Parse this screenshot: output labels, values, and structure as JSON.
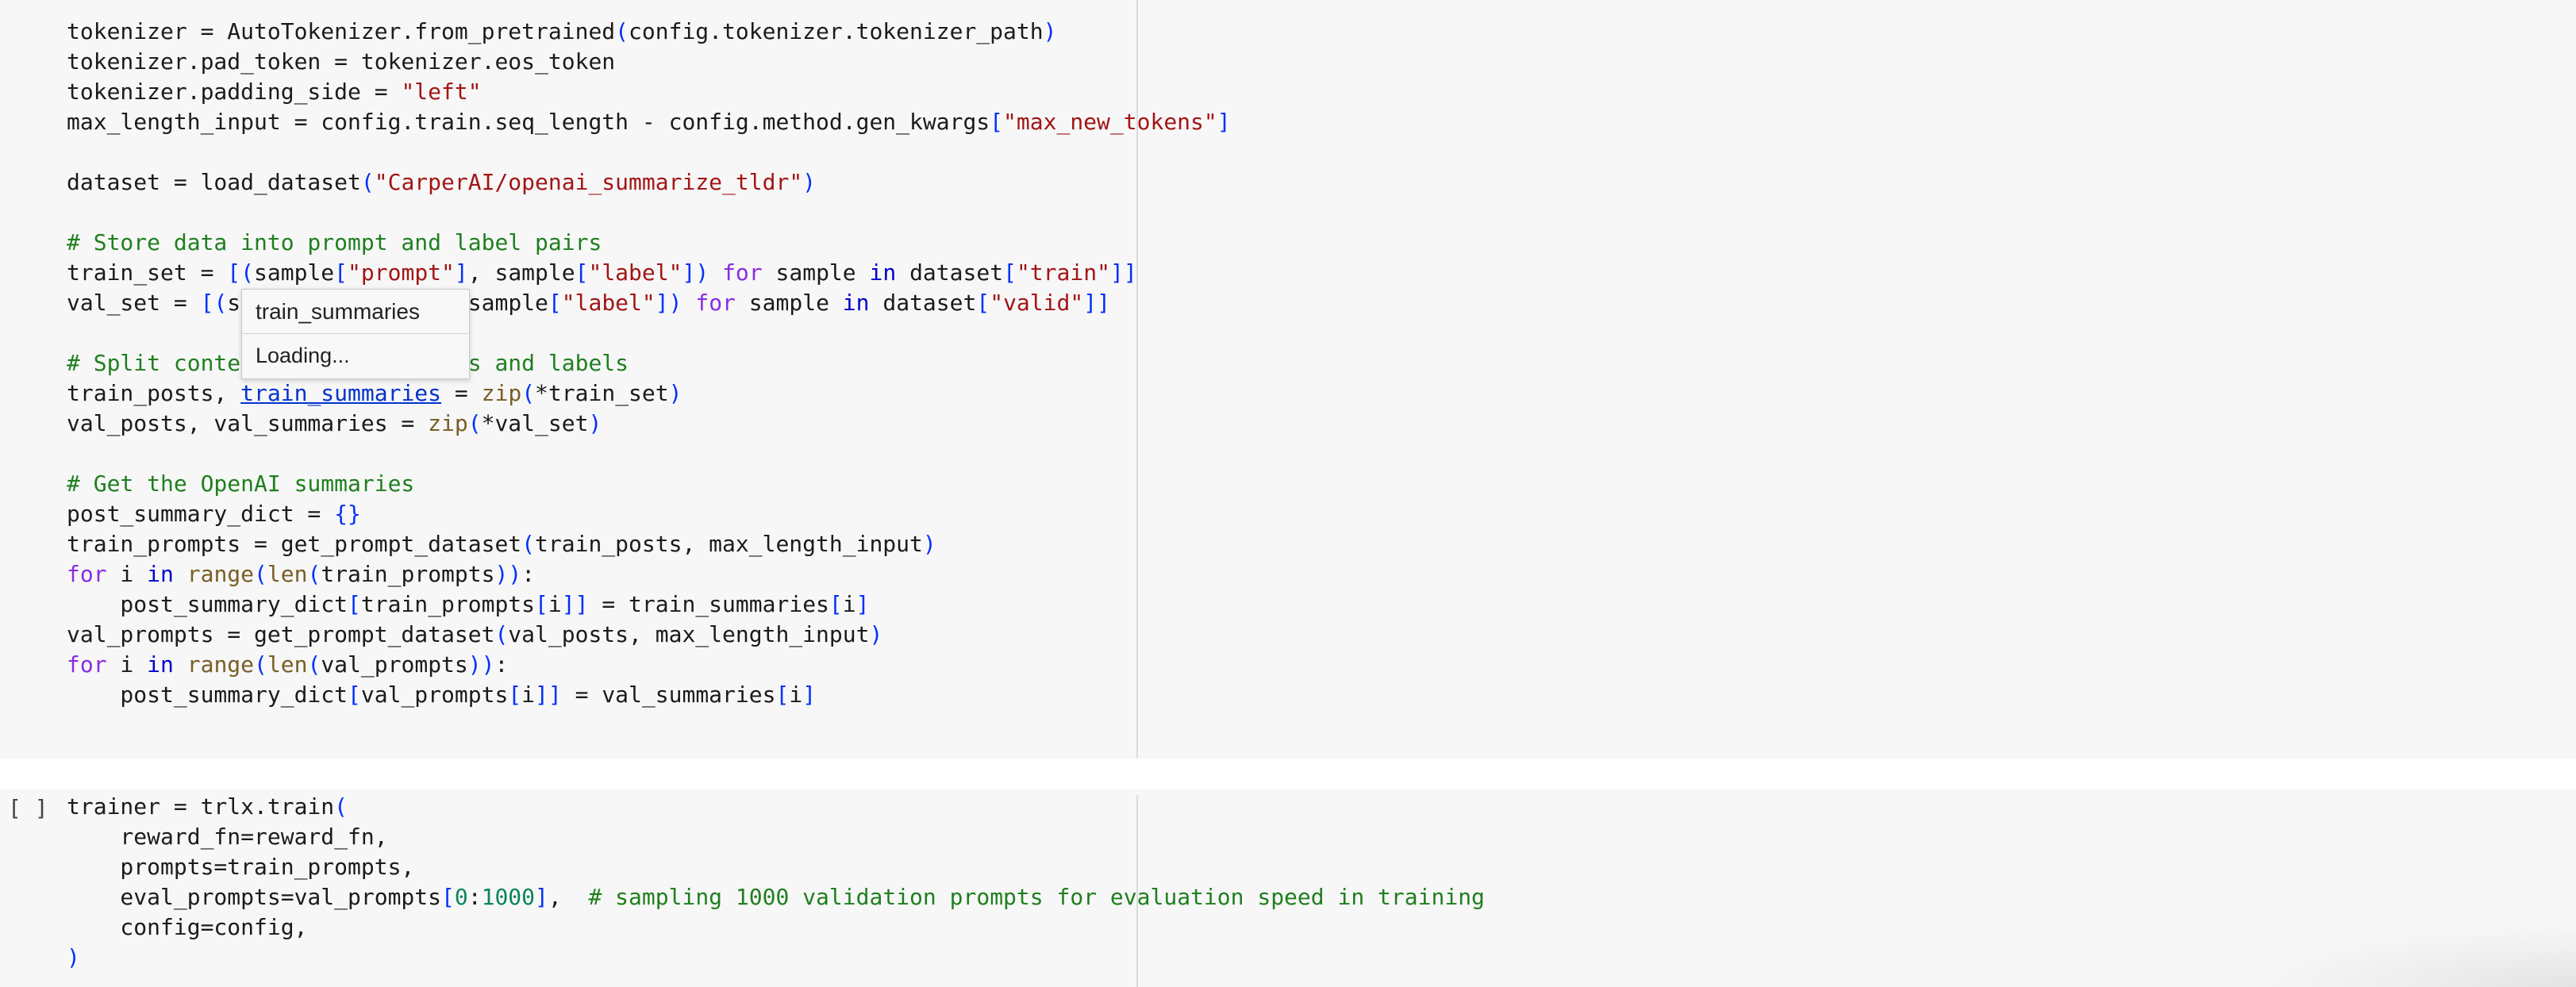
{
  "cell1": {
    "lines": [
      "tokenizer = AutoTokenizer.from_pretrained(config.tokenizer.tokenizer_path)",
      "tokenizer.pad_token = tokenizer.eos_token",
      "tokenizer.padding_side = \"left\"",
      "max_length_input = config.train.seq_length - config.method.gen_kwargs[\"max_new_tokens\"]",
      "",
      "dataset = load_dataset(\"CarperAI/openai_summarize_tldr\")",
      "",
      "# Store data into prompt and label pairs",
      "train_set = [(sample[\"prompt\"], sample[\"label\"]) for sample in dataset[\"train\"]]",
      "val_set = [(sample[\"prompt\"], sample[\"label\"]) for sample in dataset[\"valid\"]]",
      "",
      "# Split contents into summaries and labels",
      "train_posts, train_summaries = zip(*train_set)",
      "val_posts, val_summaries = zip(*val_set)",
      "",
      "# Get the OpenAI summaries",
      "post_summary_dict = {}",
      "train_prompts = get_prompt_dataset(train_posts, max_length_input)",
      "for i in range(len(train_prompts)):",
      "    post_summary_dict[train_prompts[i]] = train_summaries[i]",
      "val_prompts = get_prompt_dataset(val_posts, max_length_input)",
      "for i in range(len(val_prompts)):",
      "    post_summary_dict[val_prompts[i]] = val_summaries[i]"
    ]
  },
  "tooltip": {
    "title": "train_summaries",
    "status": "Loading..."
  },
  "cell2": {
    "run_prompt": "[ ]",
    "lines": [
      "trainer = trlx.train(",
      "    reward_fn=reward_fn,",
      "    prompts=train_prompts,",
      "    eval_prompts=val_prompts[0:1000],  # sampling 1000 validation prompts for evaluation speed in training",
      "    config=config,",
      ")"
    ]
  },
  "colors": {
    "background": "#f7f7f7",
    "string": "#a31515",
    "comment": "#1f7f1f",
    "keyword": "#0000cf",
    "builtin": "#795e26",
    "bracket": "#0431fa"
  }
}
